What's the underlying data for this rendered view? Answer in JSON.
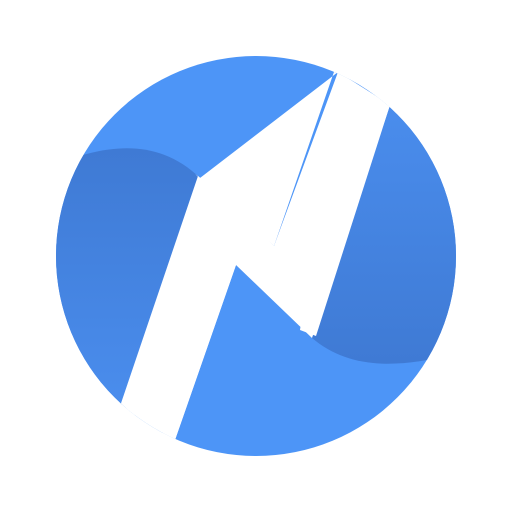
{
  "logo": {
    "icon": "blue-circle-n-logo-icon",
    "colors": {
      "background": "#ffffff",
      "primary": "#4d95f7",
      "shadow_light": "#4a8ded",
      "shadow_dark": "#3f7ad4"
    }
  }
}
